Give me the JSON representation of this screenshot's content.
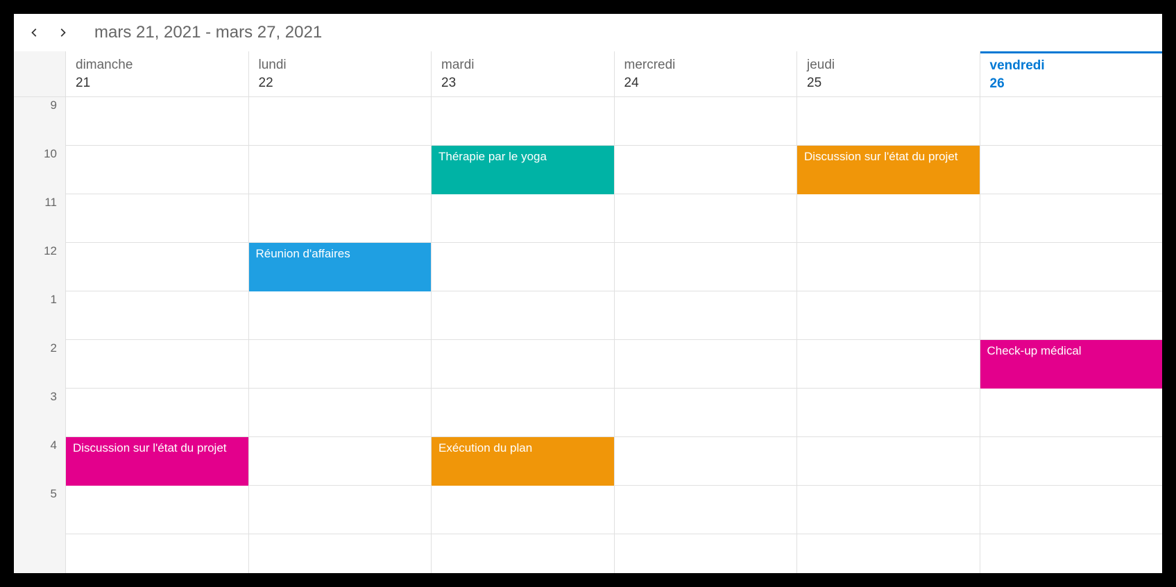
{
  "header": {
    "date_range": "mars 21, 2021 - mars 27, 2021"
  },
  "days": [
    {
      "name": "dimanche",
      "num": "21",
      "today": false
    },
    {
      "name": "lundi",
      "num": "22",
      "today": false
    },
    {
      "name": "mardi",
      "num": "23",
      "today": false
    },
    {
      "name": "mercredi",
      "num": "24",
      "today": false
    },
    {
      "name": "jeudi",
      "num": "25",
      "today": false
    },
    {
      "name": "vendredi",
      "num": "26",
      "today": true
    }
  ],
  "hours": [
    "9",
    "10",
    "11",
    "12",
    "1",
    "2",
    "3",
    "4",
    "5"
  ],
  "colors": {
    "pink": "#e3008c",
    "blue": "#1f9fe2",
    "teal": "#00b3a5",
    "orange": "#f09609",
    "today": "#0078d4"
  },
  "events": [
    {
      "title": "Discussion sur l'état du projet",
      "day": 0,
      "start_index": 7,
      "duration": 1,
      "color": "#e3008c"
    },
    {
      "title": "Réunion d'affaires",
      "day": 1,
      "start_index": 3,
      "duration": 1,
      "color": "#1f9fe2"
    },
    {
      "title": "Thérapie par le yoga",
      "day": 2,
      "start_index": 1,
      "duration": 1,
      "color": "#00b3a5"
    },
    {
      "title": "Exécution du plan",
      "day": 2,
      "start_index": 7,
      "duration": 1,
      "color": "#f09609"
    },
    {
      "title": "Discussion sur l'état du projet",
      "day": 4,
      "start_index": 1,
      "duration": 1,
      "color": "#f09609"
    },
    {
      "title": "Check-up médical",
      "day": 5,
      "start_index": 5,
      "duration": 1,
      "color": "#e3008c"
    }
  ]
}
